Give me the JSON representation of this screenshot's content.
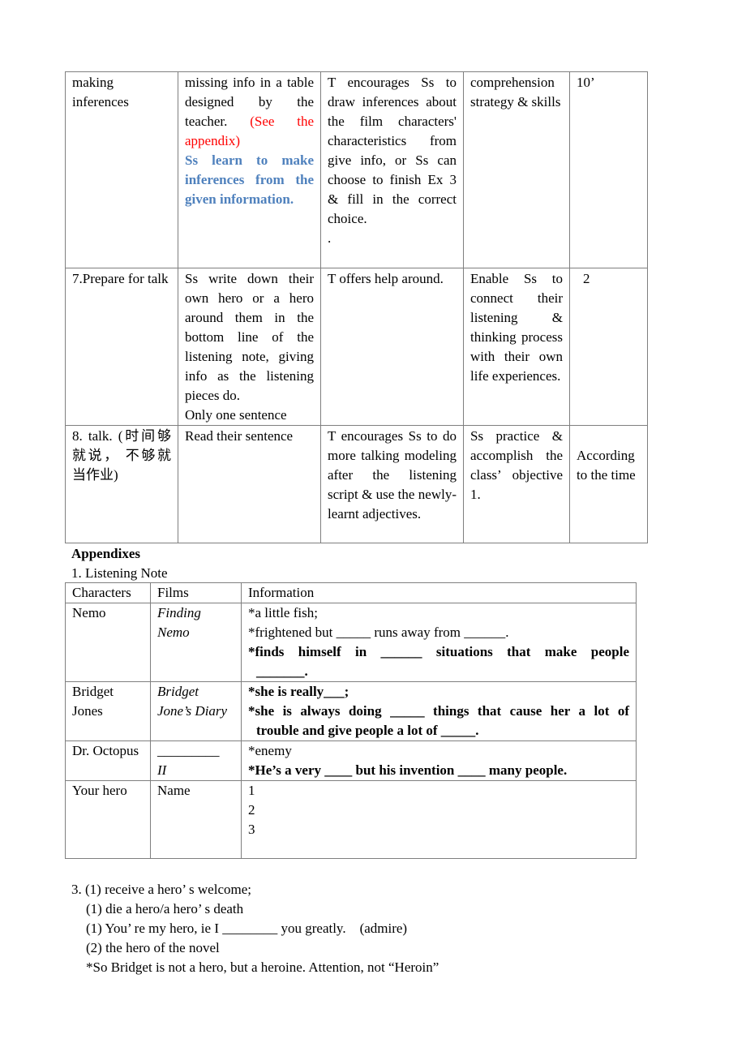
{
  "lesson_plan": {
    "rows": [
      {
        "step": "making inferences",
        "student_activity": "missing info in a table designed by the teacher.",
        "student_activity_note_red": "(See the appendix)",
        "student_activity_note_blue": "Ss learn to make inferences from the given information.",
        "teacher_activity": "T encourages Ss to draw inferences about the film characters' characteristics from give info, or Ss can choose to finish Ex 3 & fill in the correct choice.",
        "teacher_activity_extra": ".",
        "purpose": "comprehension strategy & skills",
        "time": "10’"
      },
      {
        "step": "7.Prepare for talk",
        "student_activity": "Ss write down their own hero or a hero around them in the bottom line of the listening note, giving info as the listening pieces do.",
        "student_activity_extra": "Only one sentence",
        "teacher_activity": "T offers help around.",
        "purpose": "Enable Ss to connect their listening & thinking process with their own life experiences.",
        "time": "2"
      },
      {
        "step": "8. talk. (时间够就说， 不够就当作业)",
        "student_activity": "Read their sentence",
        "teacher_activity": "T encourages Ss to do more talking modeling after the listening script & use the newly-learnt adjectives.",
        "purpose": "Ss practice & accomplish the class’ objective 1.",
        "time": "According to the time"
      }
    ]
  },
  "appendix": {
    "title": "Appendixes",
    "listening_note_title": "1. Listening Note",
    "headers": [
      "Characters",
      "Films",
      "Information"
    ],
    "rows": [
      {
        "character": "Nemo",
        "film": "Finding Nemo",
        "info": [
          "*a little fish;",
          "*frightened but _____ runs away from ______."
        ],
        "info_bold": "*finds himself in ______ situations that make people",
        "info_bold_cont": "_______."
      },
      {
        "character": "Bridget Jones",
        "film": "Bridget Jone’s Diary",
        "info_bold_1": "*she is really___;",
        "info_bold_2": "*she is always doing _____ things that cause her a lot of",
        "info_bold_2_cont": "trouble and give people a lot of _____."
      },
      {
        "character": "Dr. Octopus",
        "film_blank": "_________",
        "film": "II",
        "info": "*enemy",
        "info_bold": "*He’s a very ____ but his invention ____ many people."
      },
      {
        "character": "Your hero",
        "film": "Name",
        "info": [
          "1",
          "2",
          "3"
        ]
      }
    ]
  },
  "section3": {
    "lines": [
      "3. (1) receive a hero’ s welcome;",
      "(1) die a hero/a hero’ s death",
      "(1) You’ re my hero, ie I ________ you greatly.    (admire)",
      "(2) the hero of the novel",
      "*So Bridget is not a hero, but a heroine. Attention, not “Heroin”"
    ]
  }
}
